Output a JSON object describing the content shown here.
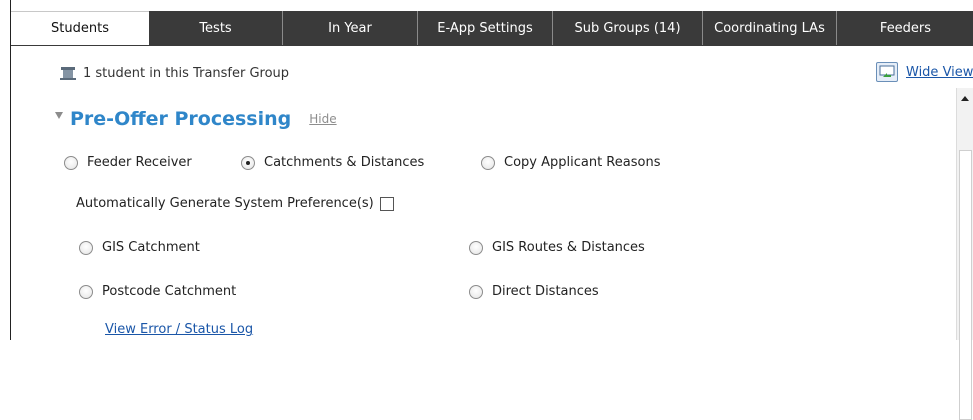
{
  "tabs": [
    {
      "label": "Students",
      "active": true
    },
    {
      "label": "Tests",
      "active": false
    },
    {
      "label": "In Year",
      "active": false
    },
    {
      "label": "E-App Settings",
      "active": false
    },
    {
      "label": "Sub Groups  (14)",
      "active": false
    },
    {
      "label": "Coordinating LAs",
      "active": false
    },
    {
      "label": "Feeders",
      "active": false
    }
  ],
  "info_text": "1 student in this Transfer Group",
  "wide_view_label": "Wide View",
  "section": {
    "title": "Pre-Offer Processing",
    "hide_label": "Hide"
  },
  "processing_options": [
    {
      "label": "Feeder Receiver",
      "checked": false
    },
    {
      "label": "Catchments & Distances",
      "checked": true
    },
    {
      "label": "Copy Applicant Reasons",
      "checked": false
    }
  ],
  "auto_generate_label": "Automatically Generate System Preference(s)",
  "auto_generate_checked": false,
  "catchment_options": [
    {
      "label": "GIS Catchment",
      "checked": false
    },
    {
      "label": "GIS Routes & Distances",
      "checked": false
    },
    {
      "label": "Postcode Catchment",
      "checked": false
    },
    {
      "label": "Direct Distances",
      "checked": false
    }
  ],
  "log_link_label": "View Error / Status Log",
  "colors": {
    "tab_dark": "#3a3a3a",
    "accent_blue": "#2f86c9",
    "link_blue": "#1a56a8"
  }
}
